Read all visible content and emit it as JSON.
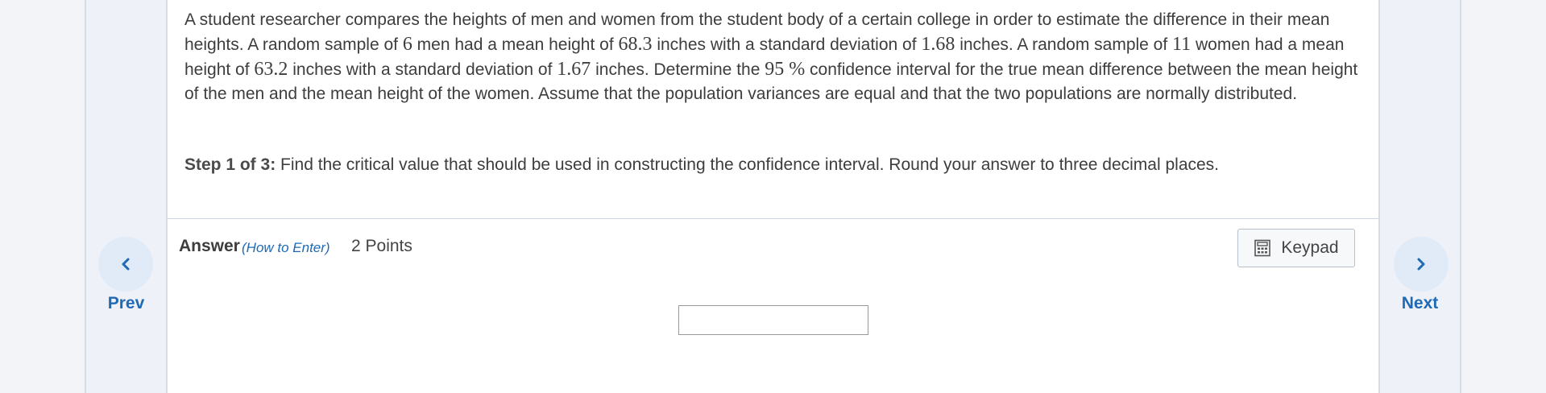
{
  "question": {
    "segments": [
      {
        "t": "A student researcher compares the heights of men and women from the student body of a certain college in order to estimate the difference in their mean heights. A random sample of "
      },
      {
        "n": "6"
      },
      {
        "t": " men had a mean height of "
      },
      {
        "n": "68.3"
      },
      {
        "t": " inches with a standard deviation of "
      },
      {
        "n": "1.68"
      },
      {
        "t": " inches. A random sample of "
      },
      {
        "n": "11"
      },
      {
        "t": " women had a mean height of "
      },
      {
        "n": "63.2"
      },
      {
        "t": " inches with a standard deviation of "
      },
      {
        "n": "1.67"
      },
      {
        "t": " inches. Determine the "
      },
      {
        "n": "95 %"
      },
      {
        "t": "  confidence interval for the true mean difference between the mean height of the men and the mean height of the women. Assume that the population variances are equal and that the two populations are normally distributed."
      }
    ]
  },
  "step": {
    "label": "Step 1 of 3:",
    "text": " Find the critical value that should be used in constructing the confidence interval. Round your answer to three decimal places."
  },
  "answer": {
    "label": "Answer",
    "how_to": "(How to Enter)",
    "points": "2 Points",
    "input_value": ""
  },
  "keypad": {
    "label": "Keypad",
    "icon": "calculator-icon"
  },
  "nav": {
    "prev_label": "Prev",
    "next_label": "Next",
    "prev_icon": "chevron-left-icon",
    "next_icon": "chevron-right-icon"
  },
  "colors": {
    "accent": "#1f6ab3",
    "nav_circle": "#e1ebf8",
    "side_panel": "#eef2f8"
  }
}
